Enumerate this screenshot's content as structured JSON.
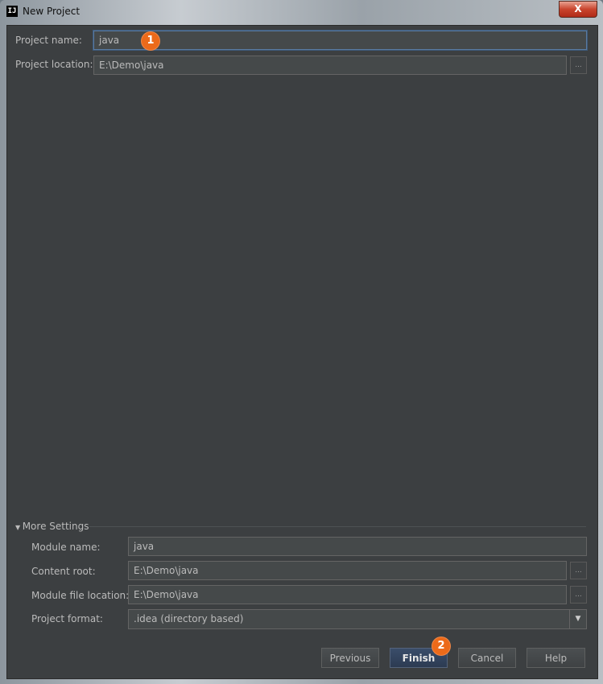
{
  "window": {
    "title": "New Project",
    "app_icon": "IJ",
    "close_label": "X"
  },
  "project": {
    "name_label": "Project name:",
    "name_value": "java",
    "location_label": "Project location:",
    "location_value": "E:\\Demo\\java",
    "browse_label": "..."
  },
  "more_settings": {
    "header": "More Settings",
    "module_name_label": "Module name:",
    "module_name_value": "java",
    "content_root_label": "Content root:",
    "content_root_value": "E:\\Demo\\java",
    "module_file_label": "Module file location:",
    "module_file_value": "E:\\Demo\\java",
    "format_label": "Project format:",
    "format_value": ".idea (directory based)",
    "browse_label": "..."
  },
  "buttons": {
    "previous": "Previous",
    "finish": "Finish",
    "cancel": "Cancel",
    "help": "Help"
  },
  "annotations": {
    "step1": "1",
    "step2": "2"
  },
  "colors": {
    "background": "#3c3f41",
    "badge": "#ec6a1a",
    "default_button": "#2c3b52"
  }
}
